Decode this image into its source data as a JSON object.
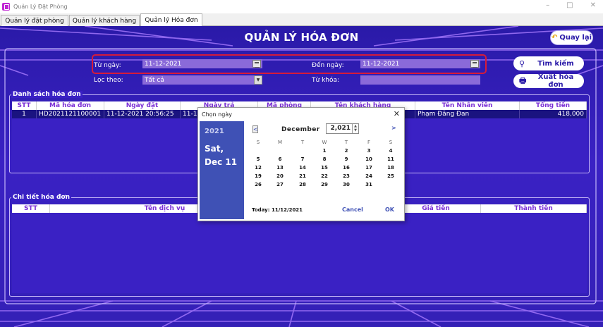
{
  "window": {
    "title": "Quản Lý Đặt Phòng",
    "controls": [
      "–",
      "□",
      "✕"
    ]
  },
  "tabs": [
    {
      "label": "Quản lý đặt phòng"
    },
    {
      "label": "Quản lý khách hàng"
    },
    {
      "label": "Quản lý Hóa đơn"
    }
  ],
  "page": {
    "title": "QUẢN LÝ HÓA ĐƠN"
  },
  "back_button": {
    "label": "Quay lại",
    "icon": "undo-arrow-icon"
  },
  "filters": {
    "from_label": "Từ ngày:",
    "from_value": "11-12-2021",
    "to_label": "Đến ngày:",
    "to_value": "11-12-2021",
    "filter_label": "Lọc theo:",
    "filter_value": "Tất cả",
    "keyword_label": "Từ khóa:",
    "keyword_value": ""
  },
  "actions": {
    "search_label": "Tìm kiếm",
    "search_icon": "magnifier-icon",
    "export_label": "Xuất hóa đơn",
    "export_icon": "printer-icon"
  },
  "invoice_list": {
    "title": "Danh sách hóa đơn",
    "columns": [
      "STT",
      "Mã hóa đơn",
      "Ngày đặt",
      "Ngày trả",
      "Mã phòng",
      "Tên khách hàng",
      "Tên Nhân viên",
      "Tổng tiền"
    ],
    "rows": [
      [
        "1",
        "HD2021121100001",
        "11-12-2021 20:56:25",
        "11-1",
        "",
        "",
        "Phạm Đăng Đan",
        "418,000"
      ]
    ]
  },
  "invoice_detail": {
    "title": "Chi tiết hóa đơn",
    "columns": [
      "STT",
      "Tên dịch vụ",
      "",
      "Giá tiền",
      "Thành tiền"
    ]
  },
  "date_picker": {
    "title": "Chọn ngày",
    "side_year": "2021",
    "side_day": "Sat,",
    "side_date": "Dec 11",
    "month": "December",
    "year": "2,021",
    "prev": "<",
    "next": ">",
    "weekdays": [
      "S",
      "M",
      "T",
      "W",
      "T",
      "F",
      "S"
    ],
    "weeks": [
      [
        "",
        "",
        "",
        "1",
        "2",
        "3",
        "4"
      ],
      [
        "5",
        "6",
        "7",
        "8",
        "9",
        "10",
        "11"
      ],
      [
        "12",
        "13",
        "14",
        "15",
        "16",
        "17",
        "18"
      ],
      [
        "19",
        "20",
        "21",
        "22",
        "23",
        "24",
        "25"
      ],
      [
        "26",
        "27",
        "28",
        "29",
        "30",
        "31",
        ""
      ]
    ],
    "today_label": "Today: 11/12/2021",
    "cancel_label": "Cancel",
    "ok_label": "OK"
  }
}
